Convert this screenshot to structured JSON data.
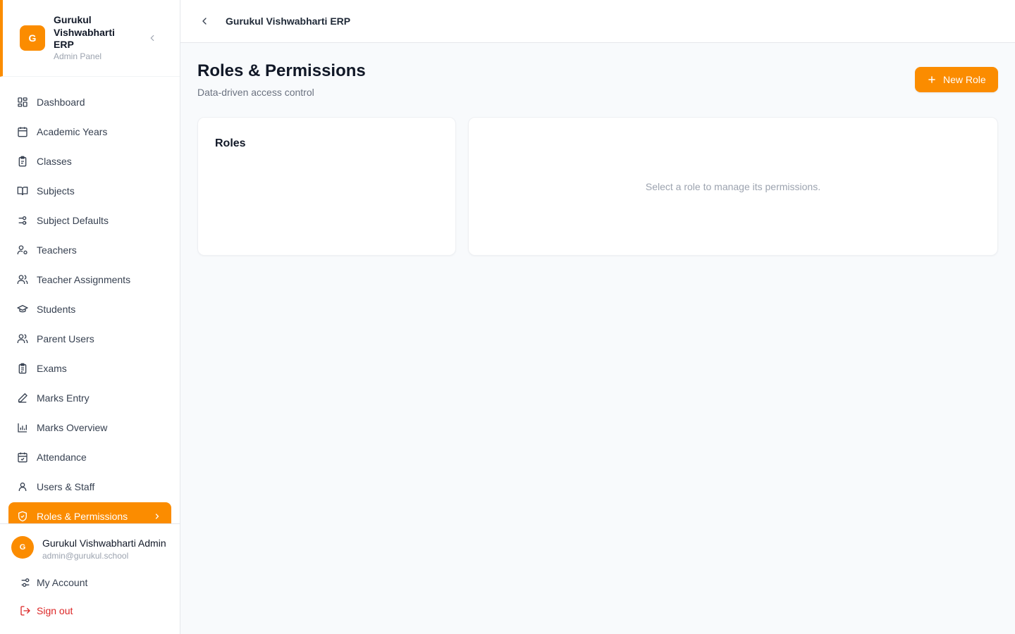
{
  "brand": {
    "logo_letter": "G",
    "title": "Gurukul Vishwabharti ERP",
    "subtitle": "Admin Panel",
    "accent": "#fb8c00"
  },
  "nav": {
    "items": [
      {
        "label": "Dashboard",
        "icon": "dashboard-icon"
      },
      {
        "label": "Academic Years",
        "icon": "calendar-icon"
      },
      {
        "label": "Classes",
        "icon": "clipboard-icon"
      },
      {
        "label": "Subjects",
        "icon": "book-icon"
      },
      {
        "label": "Subject Defaults",
        "icon": "sliders-icon"
      },
      {
        "label": "Teachers",
        "icon": "user-cog-icon"
      },
      {
        "label": "Teacher Assignments",
        "icon": "users-icon"
      },
      {
        "label": "Students",
        "icon": "graduation-cap-icon"
      },
      {
        "label": "Parent Users",
        "icon": "users-icon"
      },
      {
        "label": "Exams",
        "icon": "clipboard-list-icon"
      },
      {
        "label": "Marks Entry",
        "icon": "pencil-icon"
      },
      {
        "label": "Marks Overview",
        "icon": "bar-chart-icon"
      },
      {
        "label": "Attendance",
        "icon": "calendar-check-icon"
      },
      {
        "label": "Users & Staff",
        "icon": "user-icon"
      },
      {
        "label": "Roles & Permissions",
        "icon": "shield-check-icon",
        "active": true
      }
    ]
  },
  "user": {
    "avatar_letter": "G",
    "name": "Gurukul Vishwabharti Admin",
    "email": "admin@gurukul.school",
    "my_account_label": "My Account",
    "sign_out_label": "Sign out",
    "sign_out_color": "#dc2626"
  },
  "topbar": {
    "title": "Gurukul Vishwabharti ERP"
  },
  "page": {
    "title": "Roles & Permissions",
    "subtitle": "Data-driven access control",
    "new_role_label": "New Role"
  },
  "roles_panel": {
    "title": "Roles"
  },
  "permissions_panel": {
    "empty_text": "Select a role to manage its permissions."
  }
}
